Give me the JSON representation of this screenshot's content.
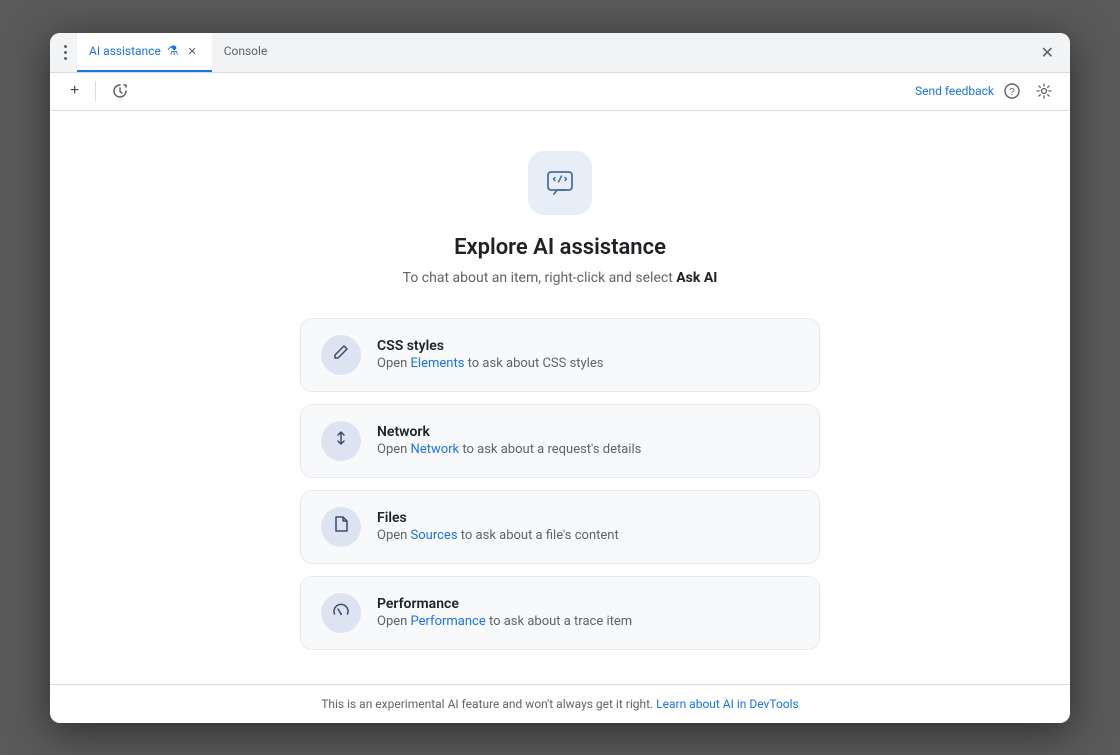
{
  "window": {
    "close_label": "✕"
  },
  "tabs": {
    "active_tab": {
      "label": "AI assistance",
      "icon": "⚗",
      "close": "✕"
    },
    "inactive_tab": {
      "label": "Console"
    }
  },
  "toolbar": {
    "add_label": "+",
    "history_label": "↺",
    "send_feedback_label": "Send feedback",
    "help_label": "?",
    "settings_label": "⚙"
  },
  "main": {
    "ai_icon_label": "AI",
    "title": "Explore AI assistance",
    "subtitle_prefix": "To chat about an item, right-click and select ",
    "subtitle_bold": "Ask AI",
    "cards": [
      {
        "id": "css-styles",
        "title": "CSS styles",
        "desc_prefix": "Open ",
        "link_text": "Elements",
        "desc_suffix": " to ask about CSS styles",
        "icon": "✏"
      },
      {
        "id": "network",
        "title": "Network",
        "desc_prefix": "Open ",
        "link_text": "Network",
        "desc_suffix": " to ask about a request's details",
        "icon": "↕"
      },
      {
        "id": "files",
        "title": "Files",
        "desc_prefix": "Open ",
        "link_text": "Sources",
        "desc_suffix": " to ask about a file's content",
        "icon": "📄"
      },
      {
        "id": "performance",
        "title": "Performance",
        "desc_prefix": "Open ",
        "link_text": "Performance",
        "desc_suffix": " to ask about a trace item",
        "icon": "⏱"
      }
    ]
  },
  "footer": {
    "text": "This is an experimental AI feature and won't always get it right. ",
    "link_text": "Learn about AI in DevTools"
  },
  "colors": {
    "accent": "#1a73e8",
    "tab_active": "#1a73e8"
  }
}
